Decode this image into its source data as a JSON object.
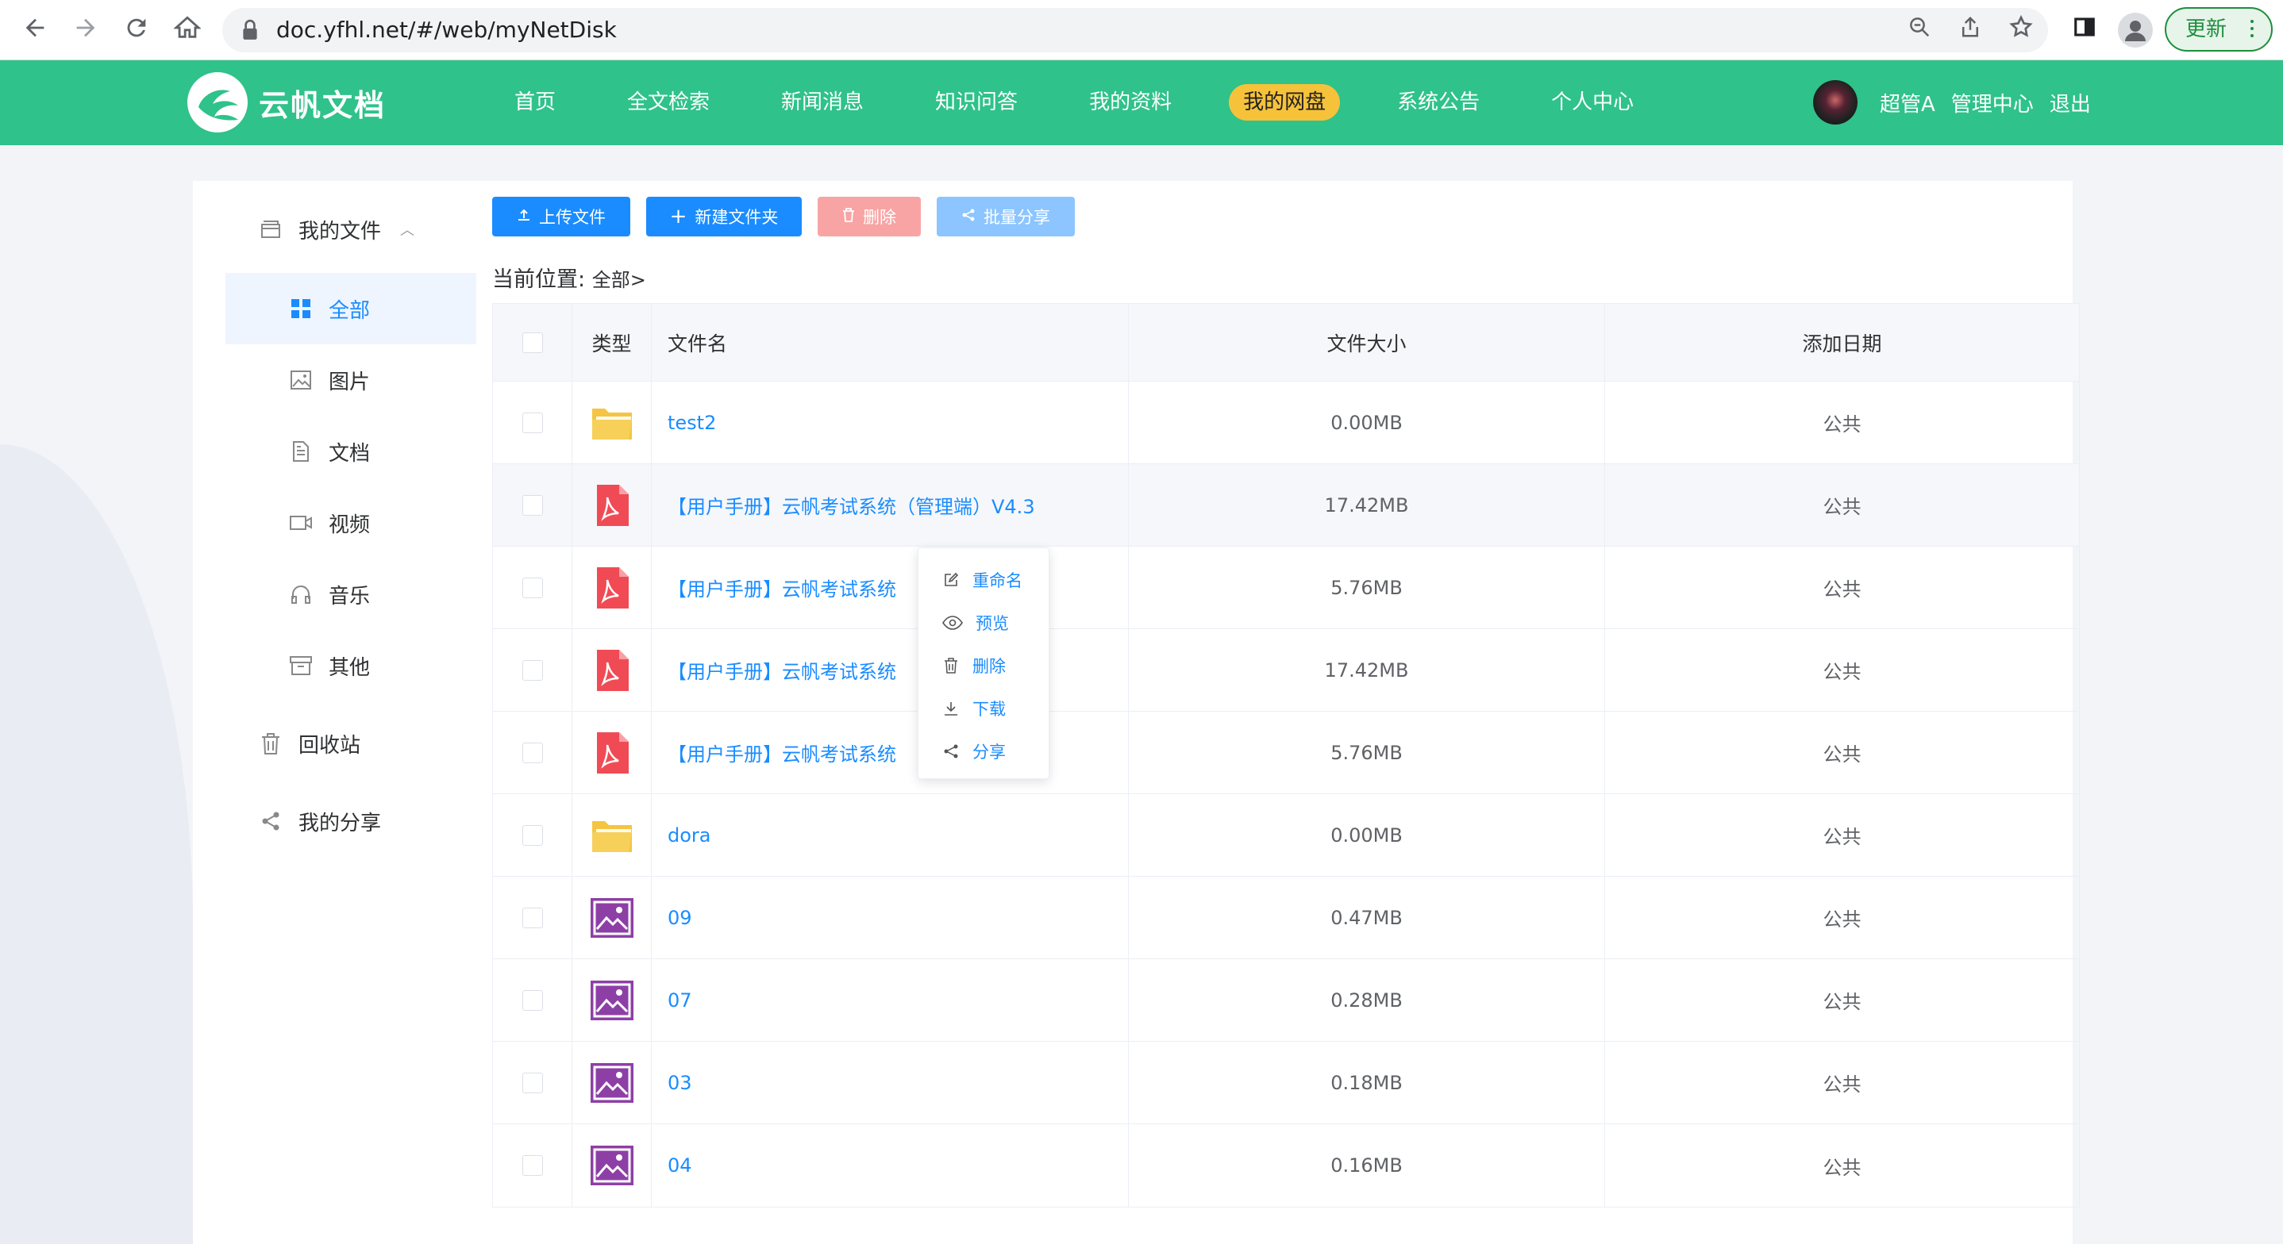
{
  "browser": {
    "url": "doc.yfhl.net/#/web/myNetDisk",
    "update_label": "更新"
  },
  "site": {
    "logo_text": "云帆文档",
    "nav": [
      {
        "label": "首页"
      },
      {
        "label": "全文检索"
      },
      {
        "label": "新闻消息"
      },
      {
        "label": "知识问答"
      },
      {
        "label": "我的资料"
      },
      {
        "label": "我的网盘",
        "active": true
      },
      {
        "label": "系统公告"
      },
      {
        "label": "个人中心"
      }
    ],
    "user_name": "超管A",
    "admin_label": "管理中心",
    "logout_label": "退出"
  },
  "sidebar": {
    "my_files": "我的文件",
    "items": [
      {
        "label": "全部",
        "icon": "grid-icon"
      },
      {
        "label": "图片",
        "icon": "image-icon"
      },
      {
        "label": "文档",
        "icon": "document-icon"
      },
      {
        "label": "视频",
        "icon": "video-icon"
      },
      {
        "label": "音乐",
        "icon": "headphones-icon"
      },
      {
        "label": "其他",
        "icon": "archive-icon"
      }
    ],
    "recycle": "回收站",
    "my_share": "我的分享"
  },
  "toolbar": {
    "upload": "上传文件",
    "new_folder": "新建文件夹",
    "delete": "删除",
    "batch_share": "批量分享"
  },
  "breadcrumb": {
    "label": "当前位置:",
    "path": "全部>"
  },
  "table": {
    "headers": [
      "类型",
      "文件名",
      "文件大小",
      "添加日期"
    ],
    "rows": [
      {
        "type": "folder",
        "name": "test2",
        "size": "0.00MB",
        "date": "公共"
      },
      {
        "type": "pdf",
        "name": "【用户手册】云帆考试系统（管理端）V4.3",
        "size": "17.42MB",
        "date": "公共"
      },
      {
        "type": "pdf",
        "name": "【用户手册】云帆考试系统",
        "size": "5.76MB",
        "date": "公共"
      },
      {
        "type": "pdf",
        "name": "【用户手册】云帆考试系统",
        "size": "17.42MB",
        "date": "公共"
      },
      {
        "type": "pdf",
        "name": "【用户手册】云帆考试系统",
        "size": "5.76MB",
        "date": "公共"
      },
      {
        "type": "folder",
        "name": "dora",
        "size": "0.00MB",
        "date": "公共"
      },
      {
        "type": "image",
        "name": "09",
        "size": "0.47MB",
        "date": "公共"
      },
      {
        "type": "image",
        "name": "07",
        "size": "0.28MB",
        "date": "公共"
      },
      {
        "type": "image",
        "name": "03",
        "size": "0.18MB",
        "date": "公共"
      },
      {
        "type": "image",
        "name": "04",
        "size": "0.16MB",
        "date": "公共"
      }
    ]
  },
  "context_menu": {
    "items": [
      {
        "label": "重命名",
        "icon": "edit-icon"
      },
      {
        "label": "预览",
        "icon": "eye-icon"
      },
      {
        "label": "删除",
        "icon": "trash-icon"
      },
      {
        "label": "下载",
        "icon": "download-icon"
      },
      {
        "label": "分享",
        "icon": "share-icon"
      }
    ]
  },
  "colors": {
    "brand_green": "#2fc28b",
    "accent_blue": "#1a8cff",
    "active_nav": "#f6c23a"
  }
}
